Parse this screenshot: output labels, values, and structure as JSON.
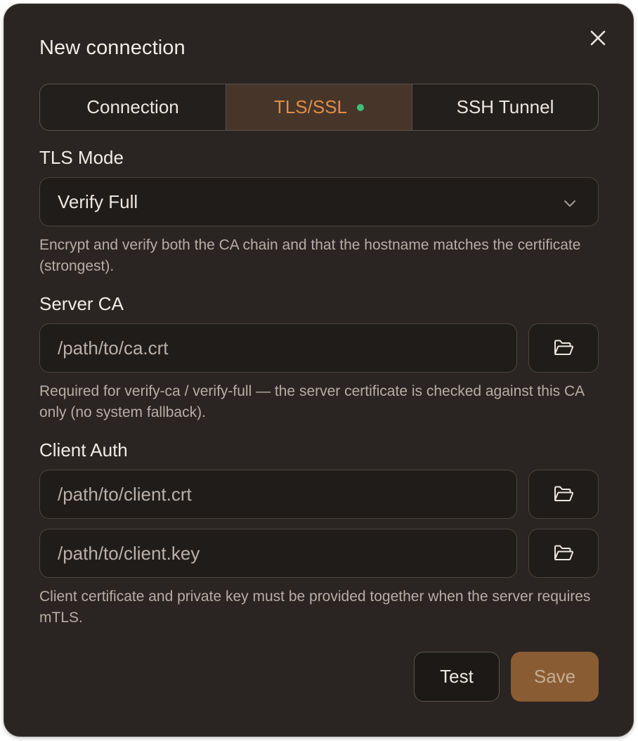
{
  "dialog": {
    "title": "New connection",
    "close_icon": "close-icon"
  },
  "tabs": [
    {
      "label": "Connection",
      "active": false
    },
    {
      "label": "TLS/SSL",
      "active": true,
      "indicator_color": "#3fbf76"
    },
    {
      "label": "SSH Tunnel",
      "active": false
    }
  ],
  "tls_mode": {
    "label": "TLS Mode",
    "selected": "Verify Full",
    "help": "Encrypt and verify both the CA chain and that the hostname matches the certificate (strongest)."
  },
  "server_ca": {
    "label": "Server CA",
    "placeholder": "/path/to/ca.crt",
    "browse_icon": "folder-open-icon",
    "help": "Required for verify-ca / verify-full — the server certificate is checked against this CA only (no system fallback)."
  },
  "client_auth": {
    "label": "Client Auth",
    "cert_placeholder": "/path/to/client.crt",
    "key_placeholder": "/path/to/client.key",
    "browse_icon": "folder-open-icon",
    "help": "Client certificate and private key must be provided together when the server requires mTLS."
  },
  "footer": {
    "test_label": "Test",
    "save_label": "Save"
  },
  "colors": {
    "background": "#2a2522",
    "accent": "#e08f43",
    "save_button": "#8a5c33",
    "status_dot": "#3fbf76"
  }
}
